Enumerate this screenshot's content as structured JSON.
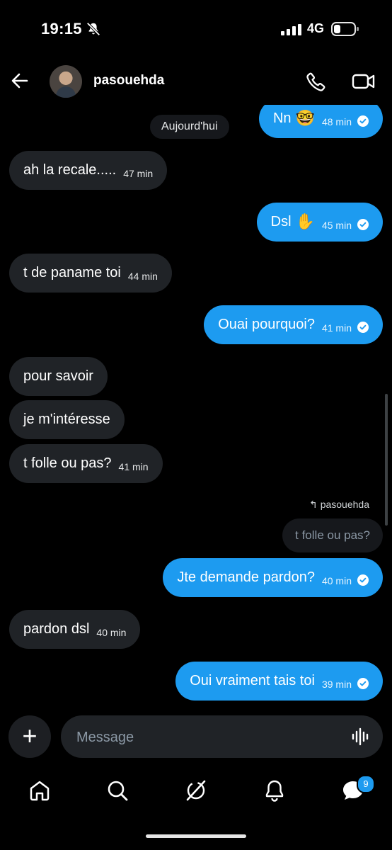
{
  "status": {
    "time": "19:15",
    "network": "4G"
  },
  "header": {
    "contact_name": "pasouehda"
  },
  "conversation": {
    "date_divider": "Aujourd'hui",
    "messages": [
      {
        "dir": "out",
        "text": "Nn",
        "emoji": "🤓",
        "time": "48 min",
        "read": true
      },
      {
        "dir": "in",
        "text": "ah la recale.....",
        "time": "47 min"
      },
      {
        "dir": "out",
        "text": "Dsl",
        "emoji": "✋",
        "time": "45 min",
        "read": true
      },
      {
        "dir": "in",
        "text": "t de paname toi",
        "time": "44 min"
      },
      {
        "dir": "out",
        "text": "Ouai pourquoi?",
        "time": "41 min",
        "read": true
      },
      {
        "dir": "in",
        "text": "pour savoir",
        "time": ""
      },
      {
        "dir": "in",
        "text": "je m'intéresse",
        "time": ""
      },
      {
        "dir": "in",
        "text": "t folle ou pas?",
        "time": "41 min"
      },
      {
        "dir": "out",
        "text": "Jte demande pardon?",
        "time": "40 min",
        "read": true
      },
      {
        "dir": "in",
        "text": "pardon dsl",
        "time": "40 min"
      },
      {
        "dir": "out",
        "text": "Oui vraiment tais toi",
        "time": "39 min",
        "read": true
      }
    ],
    "reply": {
      "to": "pasouehda",
      "quoted": "t folle ou pas?"
    }
  },
  "composer": {
    "placeholder": "Message"
  },
  "tabbar": {
    "notification_count": "9",
    "icons": [
      "home-icon",
      "search-icon",
      "grok-icon",
      "bell-icon",
      "messages-icon"
    ]
  },
  "colors": {
    "accent": "#1d9bf0",
    "incoming_bubble": "#202327",
    "background": "#000000"
  }
}
